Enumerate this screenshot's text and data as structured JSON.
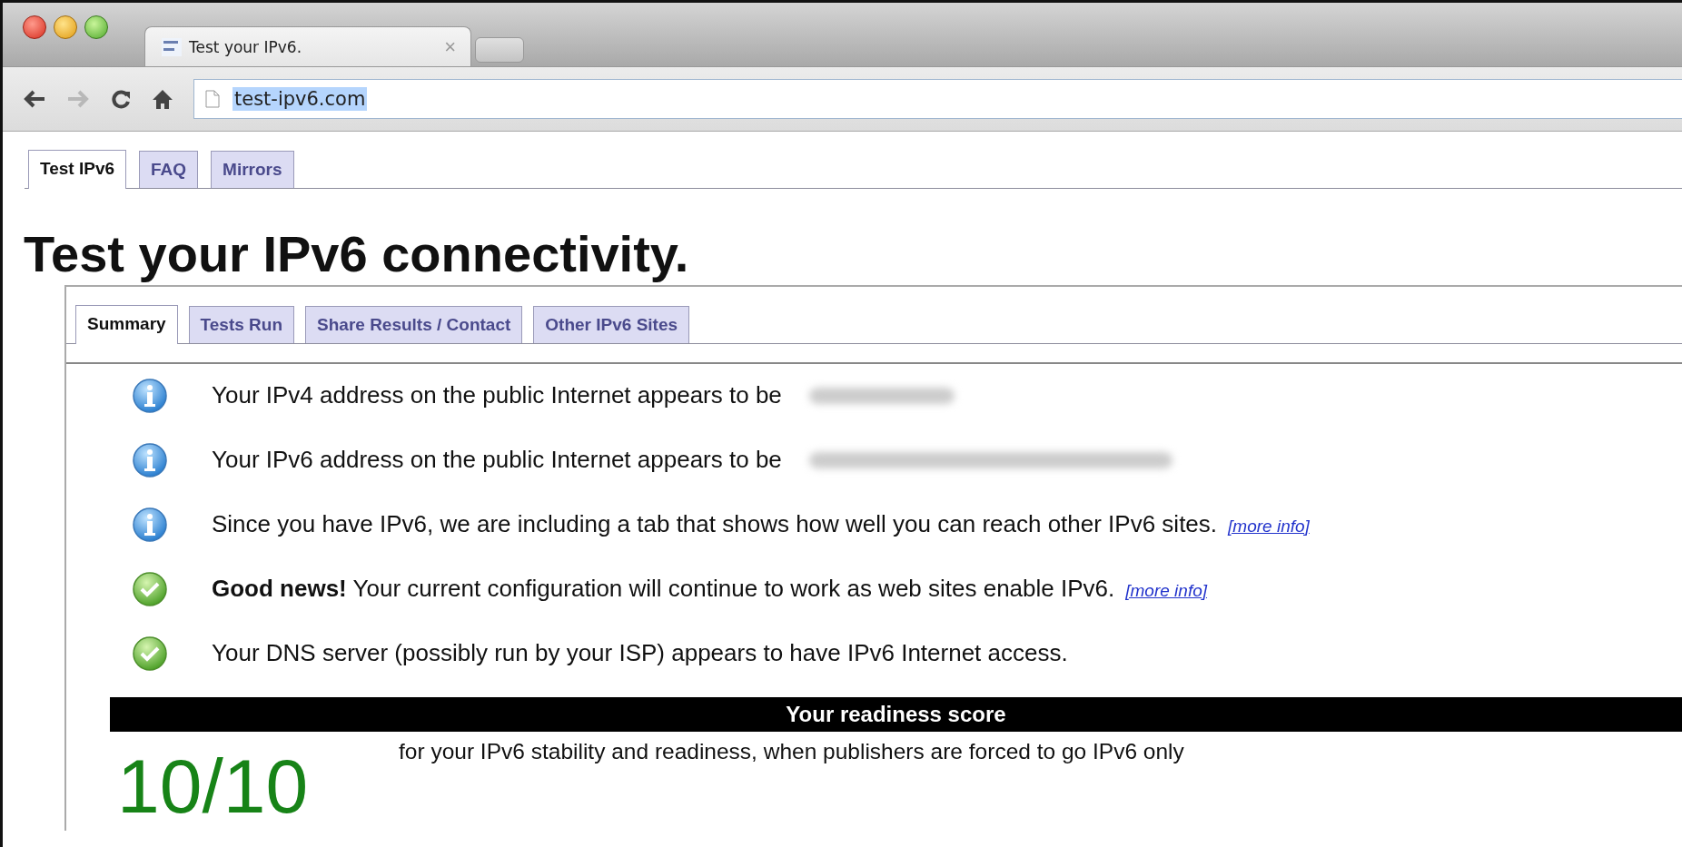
{
  "browser": {
    "tab": {
      "title": "Test your IPv6.",
      "close": "×"
    },
    "nav": {
      "forward_disabled": true
    },
    "address": {
      "url": "test-ipv6.com",
      "selected": true
    }
  },
  "site_tabs": [
    {
      "label": "Test IPv6",
      "selected": true
    },
    {
      "label": "FAQ",
      "selected": false
    },
    {
      "label": "Mirrors",
      "selected": false
    }
  ],
  "heading": "Test your IPv6 connectivity.",
  "panel_tabs": [
    {
      "label": "Summary",
      "selected": true
    },
    {
      "label": "Tests Run",
      "selected": false
    },
    {
      "label": "Share Results / Contact",
      "selected": false
    },
    {
      "label": "Other IPv6 Sites",
      "selected": false
    }
  ],
  "results": [
    {
      "kind": "info",
      "text": "Your IPv4 address on the public Internet appears to be",
      "redacted": true
    },
    {
      "kind": "info",
      "text": "Your IPv6 address on the public Internet appears to be",
      "redacted": true
    },
    {
      "kind": "info",
      "text": "Since you have IPv6, we are including a tab that shows how well you can reach other IPv6 sites.",
      "link": "[more info]",
      "redacted": false
    },
    {
      "kind": "ok",
      "text": "**Good news!** Your current configuration will continue to work as web sites enable IPv6.",
      "link": "[more info]",
      "redacted": false
    },
    {
      "kind": "ok",
      "text": "Your DNS server (possibly run by your ISP) appears to have IPv6 Internet access.",
      "redacted": false
    }
  ],
  "score": {
    "title": "Your readiness score",
    "value": "10/10",
    "description": "for your IPv6 stability and readiness, when publishers are forced to go IPv6 only"
  }
}
